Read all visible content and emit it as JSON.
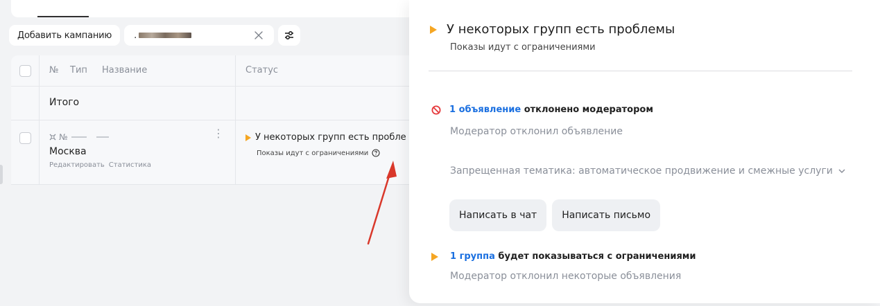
{
  "toolbar": {
    "add_campaign_label": "Добавить кампанию",
    "search_value_prefix": "."
  },
  "table": {
    "headers": {
      "number": "№",
      "type": "Тип",
      "name": "Название",
      "status": "Статус"
    },
    "total_label": "Итого",
    "campaign": {
      "id_prefix": "№",
      "name": "Москва",
      "edit_link": "Редактировать",
      "stats_link": "Статистика",
      "status_title": "У некоторых групп есть пробле",
      "status_subtitle": "Показы идут с ограничениями"
    }
  },
  "popup": {
    "title": "У некоторых групп есть проблемы",
    "subtitle": "Показы идут с ограничениями",
    "issue1": {
      "link": "1 объявление",
      "text": "отклонено модератором",
      "reason": "Модератор отклонил объявление",
      "detail": "Запрещенная тематика: автоматическое продвижение и смежные услуги"
    },
    "buttons": {
      "chat": "Написать в чат",
      "email": "Написать письмо"
    },
    "issue2": {
      "link": "1 группа",
      "text": "будет показываться с ограничениями",
      "reason": "Модератор отклонил некоторые объявления"
    }
  },
  "colors": {
    "warning": "#f5a623",
    "error": "#e5393b",
    "link": "#1a6fe0",
    "annotation_arrow": "#d9382b"
  },
  "icons": [
    "filter-icon",
    "clear-icon",
    "help-icon",
    "ban-icon",
    "warning-triangle-icon",
    "chevron-down-icon",
    "campaign-type-icon",
    "kebab-menu-icon"
  ]
}
